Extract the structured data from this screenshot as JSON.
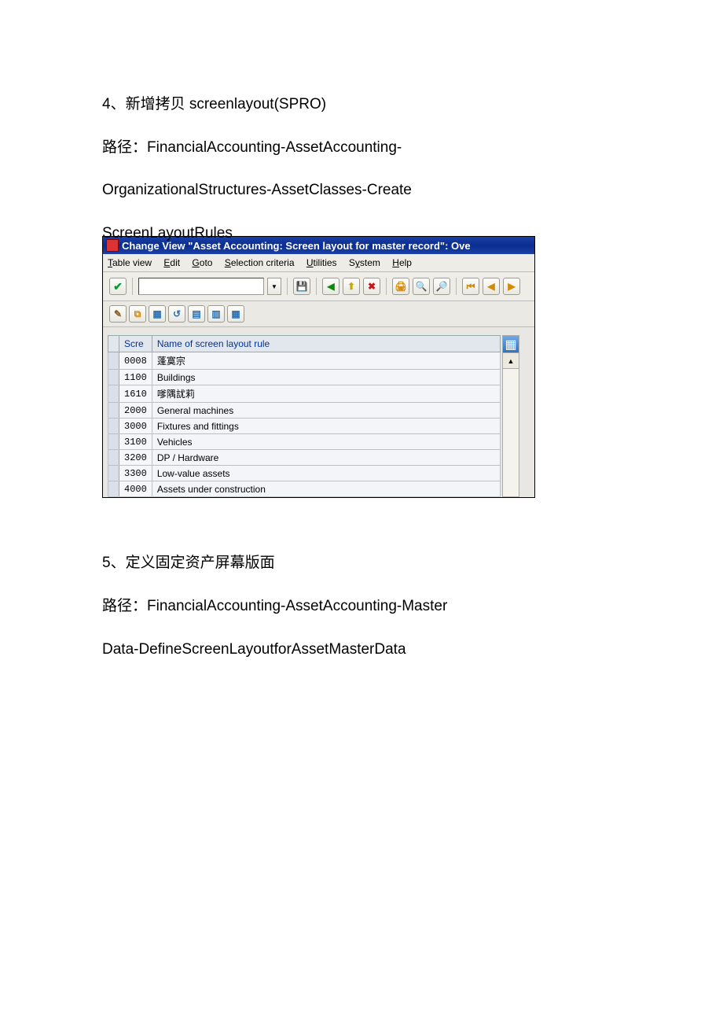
{
  "doc": {
    "section4_line1": "4、新增拷贝 screenlayout(SPRO)",
    "section4_line2": "路径：FinancialAccounting-AssetAccounting-",
    "section4_line3": "OrganizationalStructures-AssetClasses-Create",
    "section4_line4": "ScreenLayoutRules",
    "section5_line1": "5、定义固定资产屏幕版面",
    "section5_line2": "路径：FinancialAccounting-AssetAccounting-Master",
    "section5_line3": "Data-DefineScreenLayoutforAssetMasterData"
  },
  "sap": {
    "title": "Change View \"Asset Accounting: Screen layout for master record\": Ove",
    "menu": {
      "table_view": "Table view",
      "edit": "Edit",
      "goto": "Goto",
      "selection_criteria": "Selection criteria",
      "utilities": "Utilities",
      "system": "System",
      "help": "Help"
    },
    "table": {
      "col1": "Scre",
      "col2": "Name of screen layout rule",
      "rows": [
        {
          "code": "0008",
          "name": "  蓬寞宗"
        },
        {
          "code": "1100",
          "name": "Buildings"
        },
        {
          "code": "1610",
          "name": "嗲隅訧莉"
        },
        {
          "code": "2000",
          "name": "General machines"
        },
        {
          "code": "3000",
          "name": "Fixtures and fittings"
        },
        {
          "code": "3100",
          "name": "Vehicles"
        },
        {
          "code": "3200",
          "name": "DP / Hardware"
        },
        {
          "code": "3300",
          "name": "Low-value assets"
        },
        {
          "code": "4000",
          "name": "Assets under construction"
        }
      ]
    }
  }
}
